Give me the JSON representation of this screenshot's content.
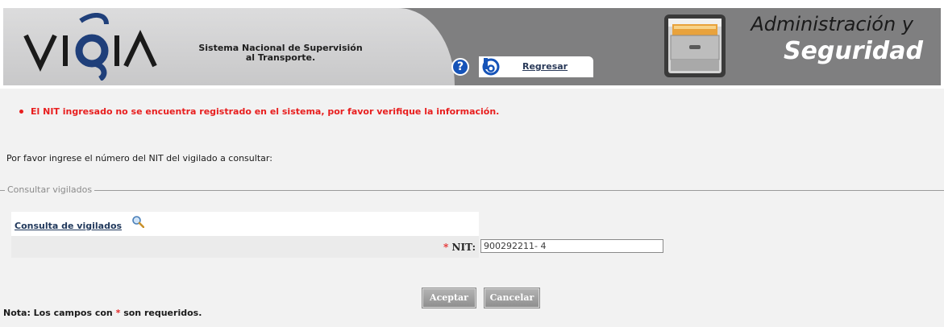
{
  "header": {
    "logo_text": "VIGIA",
    "tagline_line1": "Sistema Nacional de Supervisión",
    "tagline_line2": "al Transporte.",
    "help_glyph": "?",
    "back_label": "Regresar",
    "title_line1": "Administración y",
    "title_line2": "Seguridad"
  },
  "messages": {
    "error": "El NIT ingresado no se encuentra registrado en el sistema, por favor verifique la información.",
    "instruction": "Por favor ingrese el número del NIT del vigilado a consultar:"
  },
  "form": {
    "legend": "Consultar vigilados",
    "header_link": "Consulta de vigilados",
    "nit_star": "*",
    "nit_label": "NIT:",
    "nit_value": "900292211- 4",
    "accept_label": "Aceptar",
    "cancel_label": "Cancelar"
  },
  "note": {
    "prefix": "Nota: Los campos con",
    "star": "*",
    "suffix": "son requeridos."
  },
  "colors": {
    "error_red": "#e81e1e",
    "header_gray": "#7f7f80",
    "logo_blue": "#1f3f7a",
    "button_gray": "#a0a0a0"
  },
  "icons": {
    "help": "help-icon",
    "back": "back-icon",
    "cabinet": "file-cabinet-icon",
    "magnifier": "magnifier-icon"
  }
}
